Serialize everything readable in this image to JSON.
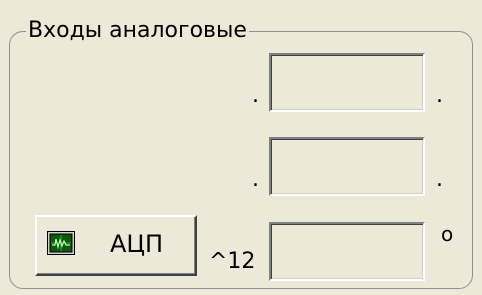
{
  "group": {
    "title": "Входы аналоговые"
  },
  "fields": [
    {
      "value": "",
      "left_label": ".",
      "right_label": "."
    },
    {
      "value": "",
      "left_label": ".",
      "right_label": "."
    },
    {
      "value": "",
      "left_label": "^12",
      "right_label": "o"
    }
  ],
  "adc_button": {
    "label": "АЦП",
    "icon": "oscilloscope-icon"
  },
  "colors": {
    "background": "#ece9d8",
    "icon_green": "#1f7a1f"
  }
}
